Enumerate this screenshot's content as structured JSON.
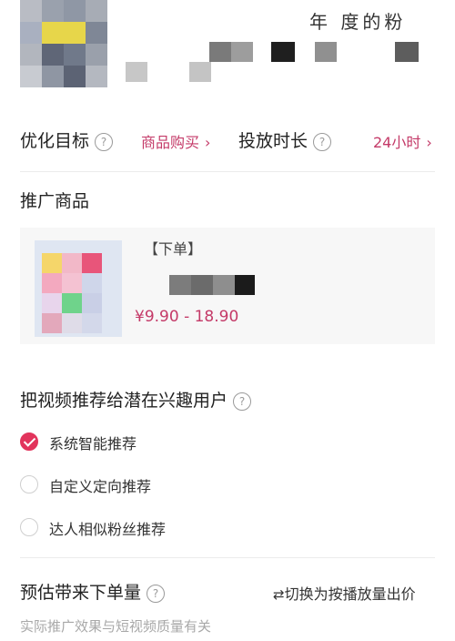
{
  "header": {
    "partial_text": "年  度的粉"
  },
  "settings": {
    "goal_label": "优化目标",
    "goal_value": "商品购买",
    "duration_label": "投放时长",
    "duration_value": "24小时"
  },
  "product_section": {
    "title": "推广商品",
    "product_title_partial": "【下单】",
    "price": "¥9.90 - 18.90"
  },
  "audience_section": {
    "title": "把视频推荐给潜在兴趣用户",
    "options": [
      {
        "label": "系统智能推荐",
        "selected": true
      },
      {
        "label": "自定义定向推荐",
        "selected": false
      },
      {
        "label": "达人相似粉丝推荐",
        "selected": false
      }
    ]
  },
  "estimate_section": {
    "title": "预估带来下单量",
    "switch_label": "切换为按播放量出价",
    "note": "实际推广效果与短视频质量有关"
  },
  "icons": {
    "help": "help-circle-icon",
    "chevron": "chevron-right-icon",
    "switch": "swap-icon",
    "check": "check-icon"
  },
  "colors": {
    "accent": "#c43a68",
    "radio_selected": "#e2345c"
  }
}
